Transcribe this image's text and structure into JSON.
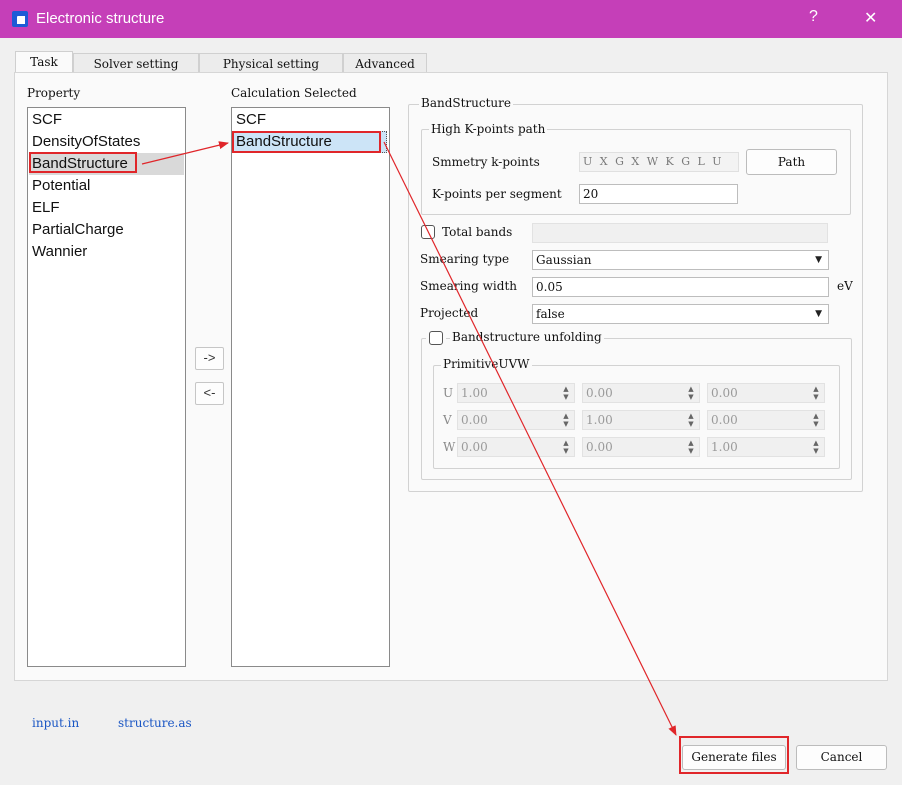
{
  "window": {
    "title": "Electronic structure",
    "help": "?",
    "close": "✕"
  },
  "tabs": [
    {
      "label": "Task"
    },
    {
      "label": "Solver setting"
    },
    {
      "label": "Physical setting"
    },
    {
      "label": "Advanced"
    }
  ],
  "property": {
    "label": "Property",
    "items": [
      "SCF",
      "DensityOfStates",
      "BandStructure",
      "Potential",
      "ELF",
      "PartialCharge",
      "Wannier"
    ],
    "selected": "BandStructure"
  },
  "calculation": {
    "label": "Calculation Selected",
    "items": [
      "SCF",
      "BandStructure"
    ],
    "selected": "BandStructure"
  },
  "move_buttons": {
    "add": "->",
    "remove": "<-"
  },
  "bandstructure": {
    "group_label": "BandStructure",
    "kpath": {
      "group_label": "High K-points path",
      "symmetry_label": "Smmetry k-points",
      "symmetry_value": "U X G X W K G L U W L",
      "path_button": "Path",
      "per_segment_label": "K-points per segment",
      "per_segment_value": "20"
    },
    "total_bands": {
      "label": "Total bands",
      "checked": false,
      "value": ""
    },
    "smearing_type": {
      "label": "Smearing type",
      "value": "Gaussian"
    },
    "smearing_width": {
      "label": "Smearing width",
      "value": "0.05",
      "unit": "eV"
    },
    "projected": {
      "label": "Projected",
      "value": "false"
    },
    "unfolding": {
      "label": "Bandstructure unfolding",
      "checked": false,
      "uvw_label": "PrimitiveUVW",
      "rows": [
        {
          "label": "U",
          "values": [
            "1.00",
            "0.00",
            "0.00"
          ]
        },
        {
          "label": "V",
          "values": [
            "0.00",
            "1.00",
            "0.00"
          ]
        },
        {
          "label": "W",
          "values": [
            "0.00",
            "0.00",
            "1.00"
          ]
        }
      ]
    }
  },
  "files": {
    "input": "input.in",
    "structure": "structure.as"
  },
  "footer": {
    "generate": "Generate files",
    "cancel": "Cancel"
  },
  "colors": {
    "titlebar": "#c53fb8",
    "highlight": "#e0262a",
    "selection": "#cce4f7"
  }
}
